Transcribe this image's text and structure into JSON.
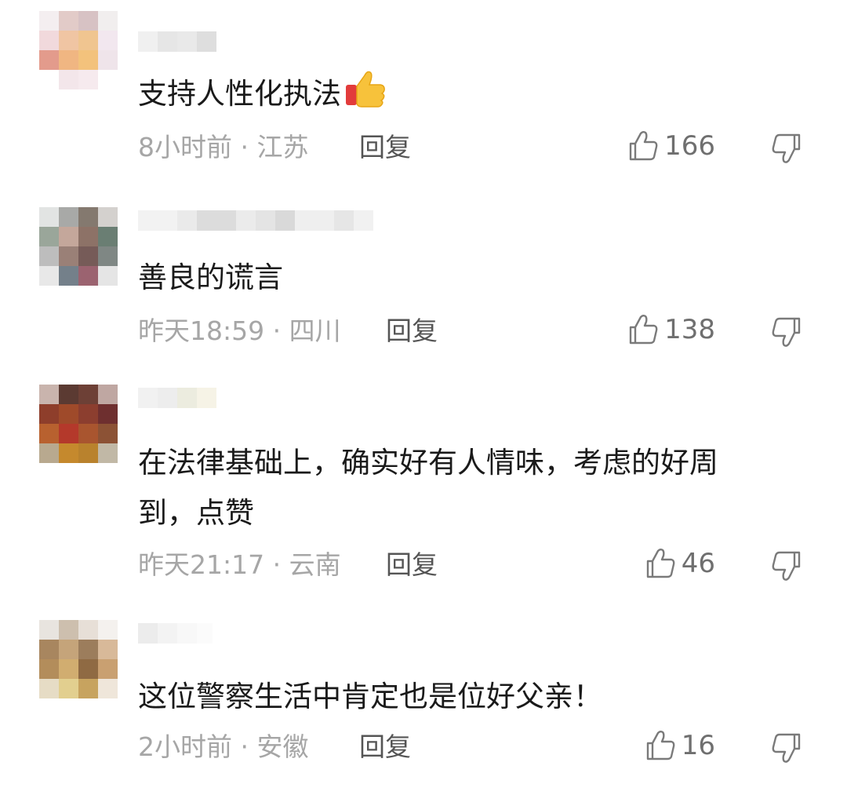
{
  "comments": [
    {
      "text": "支持人性化执法",
      "emoji": "thumbs-up-emoji",
      "time": "8小时前",
      "location": "江苏",
      "reply_label": "回复",
      "likes": "166"
    },
    {
      "text": "善良的谎言",
      "time": "昨天18:59",
      "location": "四川",
      "reply_label": "回复",
      "likes": "138"
    },
    {
      "text_line1": "在法律基础上，确实好有人情味，考虑的好周",
      "text_line2": "到，点赞",
      "time": "昨天21:17",
      "location": "云南",
      "reply_label": "回复",
      "likes": "46"
    },
    {
      "text": "这位警察生活中肯定也是位好父亲！",
      "time": "2小时前",
      "location": "安徽",
      "reply_label": "回复",
      "likes": "16"
    }
  ],
  "icons": {
    "like": "thumbs-up-outline-icon",
    "dislike": "thumbs-down-outline-icon"
  },
  "colors": {
    "text": "#1a1a1a",
    "meta": "#a6a6a6",
    "reply": "#555555"
  }
}
